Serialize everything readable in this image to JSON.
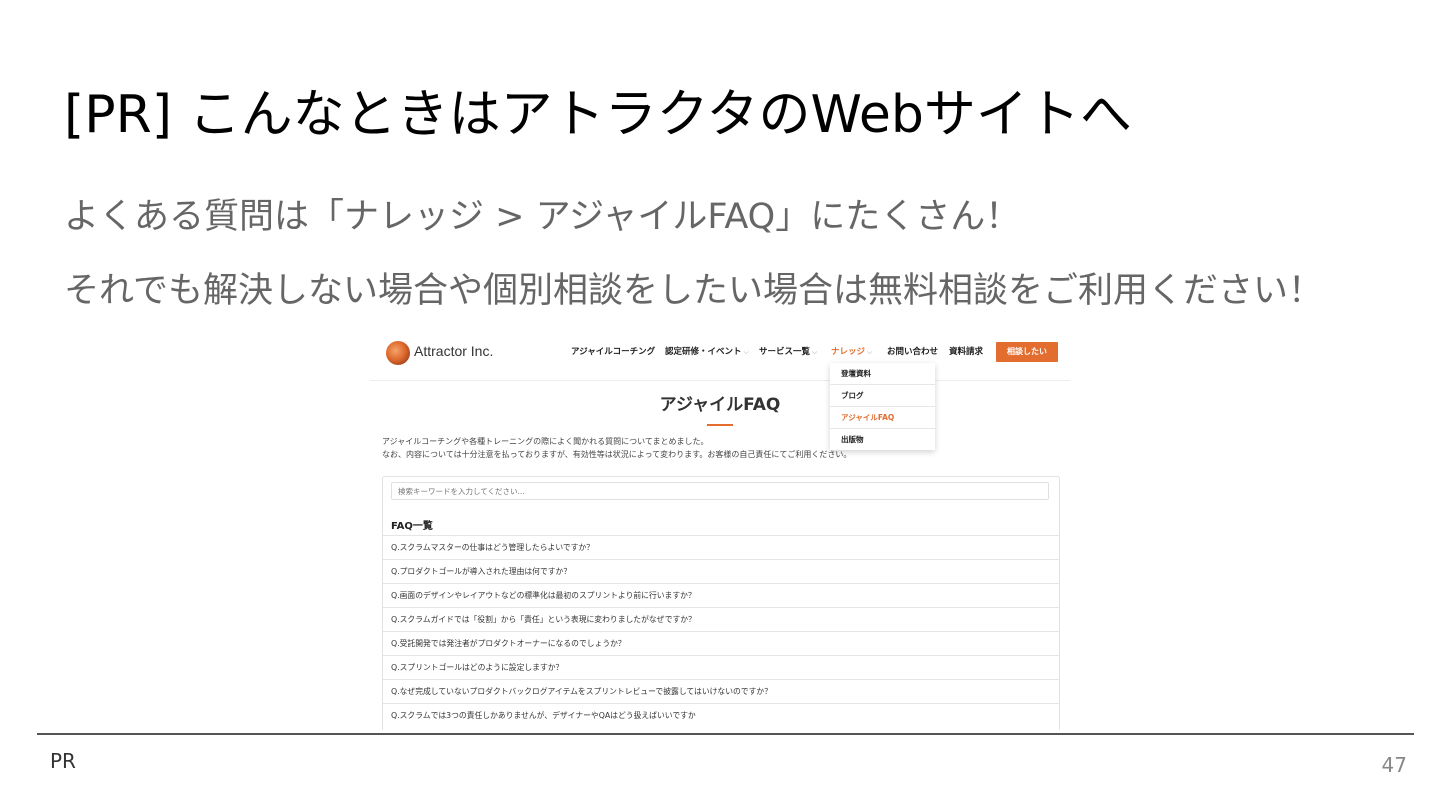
{
  "slide": {
    "title": "[PR] こんなときはアトラクタのWebサイトへ",
    "line1": "よくある質問は「ナレッジ > アジャイルFAQ」にたくさん！",
    "line2": "それでも解決しない場合や個別相談をしたい場合は無料相談をご利用ください！",
    "footer_label": "PR",
    "page_number": "47"
  },
  "site": {
    "logo_text": "Attractor Inc.",
    "nav": [
      {
        "label": "アジャイルコーチング",
        "has_dropdown": false
      },
      {
        "label": "認定研修・イベント",
        "has_dropdown": true
      },
      {
        "label": "サービス一覧",
        "has_dropdown": true
      },
      {
        "label": "ナレッジ",
        "has_dropdown": true,
        "active": true
      },
      {
        "label": "お問い合わせ",
        "has_dropdown": false
      },
      {
        "label": "資料請求",
        "has_dropdown": false
      }
    ],
    "chevron_glyph": "⌵",
    "cta_label": "相談したい",
    "dropdown": [
      "登壇資料",
      "ブログ",
      "アジャイルFAQ",
      "出版物"
    ],
    "dropdown_active_index": 2,
    "page_title": "アジャイルFAQ",
    "intro_line1": "アジャイルコーチングや各種トレーニングの際によく聞かれる質問についてまとめました。",
    "intro_line2": "なお、内容については十分注意を払っておりますが、有効性等は状況によって変わります。お客様の自己責任にてご利用ください。",
    "search_placeholder": "検索キーワードを入力してください...",
    "faq_list_title": "FAQ一覧",
    "faq_items": [
      "Q.スクラムマスターの仕事はどう管理したらよいですか？",
      "Q.プロダクトゴールが導入された理由は何ですか？",
      "Q.画面のデザインやレイアウトなどの標準化は最初のスプリントより前に行いますか？",
      "Q.スクラムガイドでは「役割」から「責任」という表現に変わりましたがなぜですか？",
      "Q.受託開発では発注者がプロダクトオーナーになるのでしょうか？",
      "Q.スプリントゴールはどのように設定しますか？",
      "Q.なぜ完成していないプロダクトバックログアイテムをスプリントレビューで披露してはいけないのですか？",
      "Q.スクラムでは3つの責任しかありませんが、デザイナーやQAはどう扱えばいいですか"
    ],
    "accent_color": "#e36c2f"
  }
}
